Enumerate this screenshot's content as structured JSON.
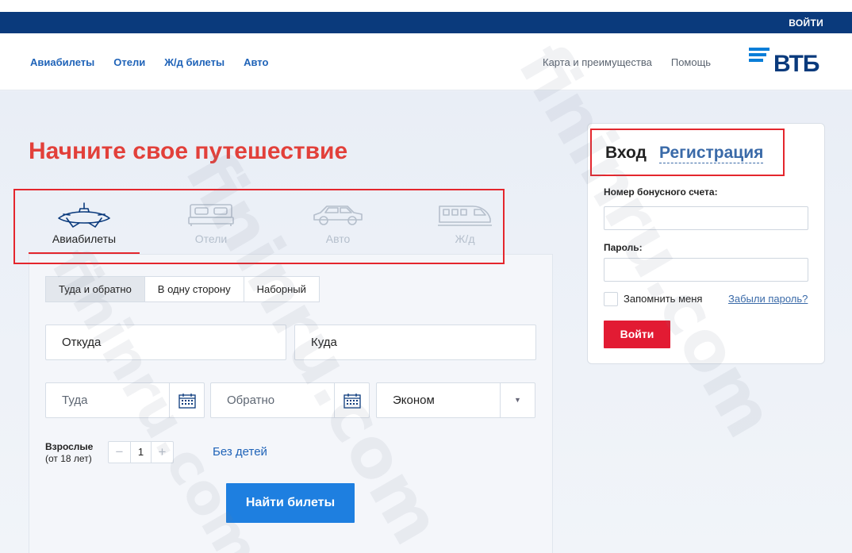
{
  "topbar": {
    "login_label": "ВОЙТИ"
  },
  "header": {
    "nav_left": [
      "Авиабилеты",
      "Отели",
      "Ж/д билеты",
      "Авто"
    ],
    "nav_right": [
      "Карта и преимущества",
      "Помощь"
    ],
    "logo_text": "ВТБ"
  },
  "main": {
    "headline": "Начните свое путешествие",
    "mode_tabs": [
      {
        "label": "Авиабилеты",
        "icon": "airplane-icon",
        "active": true
      },
      {
        "label": "Отели",
        "icon": "bed-icon",
        "active": false
      },
      {
        "label": "Авто",
        "icon": "car-icon",
        "active": false
      },
      {
        "label": "Ж/д",
        "icon": "train-icon",
        "active": false
      }
    ],
    "trip_types": [
      {
        "label": "Туда и обратно",
        "active": true
      },
      {
        "label": "В одну сторону",
        "active": false
      },
      {
        "label": "Наборный",
        "active": false
      }
    ],
    "from_placeholder": "Откуда",
    "to_placeholder": "Куда",
    "depart_placeholder": "Туда",
    "return_placeholder": "Обратно",
    "class_value": "Эконом",
    "adults_label": "Взрослые",
    "adults_sublabel": "(от 18 лет)",
    "adults_count": "1",
    "minus_label": "−",
    "plus_label": "+",
    "no_kids_link": "Без детей",
    "search_button": "Найти билеты"
  },
  "login_card": {
    "tab_enter": "Вход",
    "tab_register": "Регистрация",
    "bonus_label": "Номер бонусного счета:",
    "password_label": "Пароль:",
    "remember_label": "Запомнить меня",
    "forgot_link": "Забыли пароль?",
    "submit_label": "Войти"
  },
  "watermark": "fininru.com",
  "colors": {
    "brand_navy": "#0a3a7c",
    "accent_red": "#e2403a",
    "link_blue": "#1f63b8",
    "button_blue": "#1e7fe0",
    "button_red": "#e21b33"
  }
}
